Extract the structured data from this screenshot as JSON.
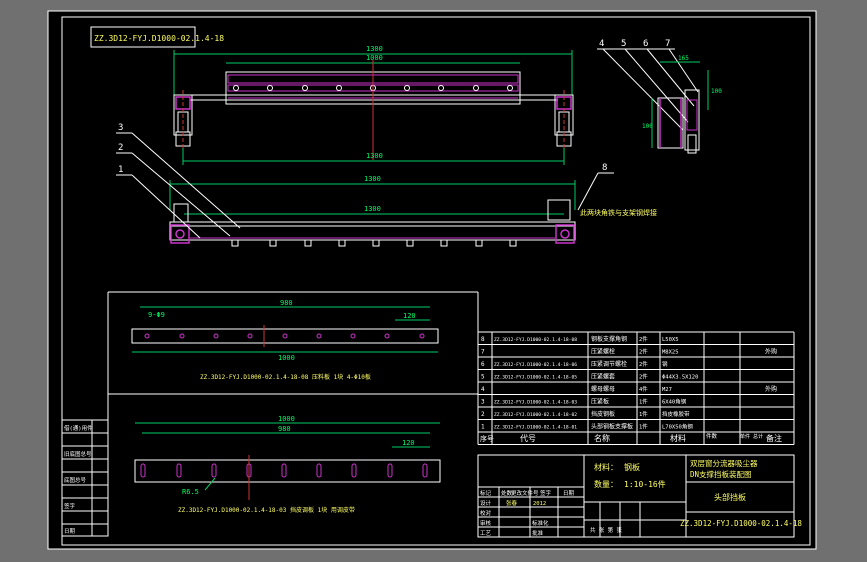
{
  "colors": {
    "background": "#707070",
    "sheet": "#000000",
    "frame": "#ffffff",
    "outline": "#ffffff",
    "dimension": "#00cc66",
    "dim_text": "#00ff66",
    "part_magenta": "#cc33cc",
    "center_line": "#cc3333",
    "label_yellow": "#ffff66",
    "table_text": "#ffffff"
  },
  "drawing_number_box": "ZZ.3D12-FYJ.D1000-02.1.4-18",
  "top_view": {
    "dim_overall": "1300",
    "dim_inner": "1000",
    "dim_bottom": "1300"
  },
  "front_view": {
    "dim_overall": "1300",
    "dim_inner": "1300",
    "note": "此两块角铁与支架钢焊接",
    "balloons": [
      "1",
      "2",
      "3",
      "8"
    ]
  },
  "side_view": {
    "balloons": [
      "4",
      "5",
      "6",
      "7"
    ],
    "dim_top": "165",
    "dim_right": "100",
    "dim_height": "100"
  },
  "detail_upper": {
    "dim_top": "980",
    "dim_left": "9-Φ9",
    "dim_right": "120",
    "dim_bottom": "1000",
    "caption": "ZZ.3D12-FYJ.D1000-02.1.4-18-08     压料板     1块     4-Φ10板"
  },
  "detail_lower": {
    "dim_top": "1000",
    "dim_mid": "980",
    "dim_right": "120",
    "slot_label": "R6.5",
    "caption": "ZZ.3D12-FYJ.D1000-02.1.4-18-03     挡皮调板     1块     用调皮带"
  },
  "left_strip": {
    "rows": [
      "借(通)用件",
      "",
      "旧底图总号",
      "",
      "底图总号",
      "",
      "签字",
      "",
      "日期"
    ]
  },
  "parts_table": {
    "rows": [
      {
        "no": "8",
        "code": "ZZ.3D12-FYJ.D1000-02.1.4-18-08",
        "name": "钢板支撑角钢",
        "qty": "2件",
        "mat": "L50X5",
        "note": ""
      },
      {
        "no": "7",
        "code": "",
        "name": "压紧螺栓",
        "qty": "2件",
        "mat": "M8X25",
        "note": "外购"
      },
      {
        "no": "6",
        "code": "ZZ.3D12-FYJ.D1000-02.1.4-18-06",
        "name": "压紧调节螺栓",
        "qty": "2件",
        "mat": "钢",
        "note": ""
      },
      {
        "no": "5",
        "code": "ZZ.3D12-FYJ.D1000-02.1.4-18-05",
        "name": "压紧螺套",
        "qty": "2件",
        "mat": "Φ44X3.5X120",
        "note": ""
      },
      {
        "no": "4",
        "code": "",
        "name": "螺母螺母",
        "qty": "4件",
        "mat": "M27",
        "note": "外购"
      },
      {
        "no": "3",
        "code": "ZZ.3D12-FYJ.D1000-02.1.4-18-03",
        "name": "压紧板",
        "qty": "1件",
        "mat": "6X40角钢",
        "note": ""
      },
      {
        "no": "2",
        "code": "ZZ.3D12-FYJ.D1000-02.1.4-18-02",
        "name": "挡皮钢板",
        "qty": "1件",
        "mat": "挡皮橡胶带",
        "note": ""
      },
      {
        "no": "1",
        "code": "ZZ.3D12-FYJ.D1000-02.1.4-18-01",
        "name": "头部钢板支撑板",
        "qty": "1件",
        "mat": "L70X50角钢",
        "note": ""
      }
    ],
    "header": {
      "no": "序号",
      "code": "代号",
      "name": "名称",
      "mat": "材料",
      "qty": "件数",
      "weight": "单件 总计",
      "note": "备注"
    }
  },
  "title_block": {
    "mass_label": "材料：",
    "mass_value": "钢板",
    "scale_label": "数量：",
    "scale_value": "1:10-16件",
    "title_line1": "双层窗分流器吸尘器",
    "title_line2": "DN支撑挡板装配图",
    "subtitle": "头部挡板",
    "drawing_no": "ZZ.3D12-FYJ.D1000-02.1.4-18",
    "sheet_text": "共 张 第 张",
    "sign_rows": [
      "标记",
      "处数",
      "更改文件号",
      "签字",
      "日期",
      "设计",
      "校对",
      "审核",
      "工艺",
      "批准"
    ],
    "std_label": "标准化",
    "date_label": "日期",
    "designer": "张春",
    "design_date": "2012"
  }
}
